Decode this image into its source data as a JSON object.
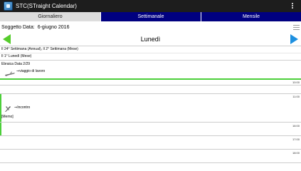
{
  "app": {
    "title": "STC(STraight Calendar)"
  },
  "tabs": [
    {
      "label": "Giornaliero",
      "active": true
    },
    {
      "label": "Settimanale",
      "active": false
    },
    {
      "label": "Mensile",
      "active": false
    }
  ],
  "subject": {
    "label": "Soggetto Data:",
    "value": "6-giugno 2016"
  },
  "nav": {
    "day_title": "Lunedì"
  },
  "info": {
    "week_line": "Il 24° Settimana (Annual), Il 2° Settimana (Mese)",
    "monday_line": "Il 1° Lunedì (Mese)",
    "hebrew_date": "Ebraica Data 2/29"
  },
  "events": [
    {
      "label": "viaggio di lavoro",
      "icon": "airplane-icon"
    },
    {
      "label": "Incontro",
      "icon": "handshake-icon"
    }
  ],
  "memo_label": "[Memo]",
  "hours": [
    "10:00",
    "11:00",
    "16:00",
    "17:00",
    "18:00"
  ],
  "colors": {
    "titlebar": "#1d1d1d",
    "tab_active": "#dddddd",
    "tab_inactive": "#000080",
    "accent_green": "#4ccf3a",
    "arrow_left": "#55cc2b",
    "arrow_right": "#1e90e0"
  }
}
